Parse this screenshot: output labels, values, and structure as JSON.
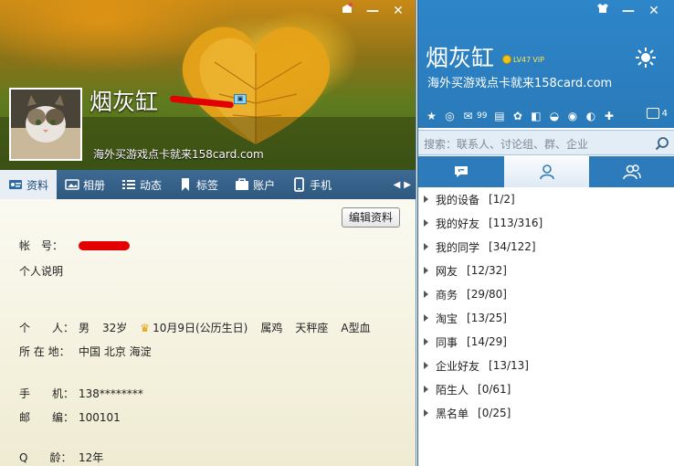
{
  "profile": {
    "nickname": "烟灰缸",
    "signature": "海外买游戏点卡就来158card.com",
    "edit_button": "编辑资料",
    "tabs": [
      {
        "label": "资料",
        "icon": "id-card-icon"
      },
      {
        "label": "相册",
        "icon": "photo-icon"
      },
      {
        "label": "动态",
        "icon": "feed-icon"
      },
      {
        "label": "标签",
        "icon": "bookmark-icon"
      },
      {
        "label": "账户",
        "icon": "wallet-icon"
      },
      {
        "label": "手机",
        "icon": "phone-icon"
      }
    ],
    "fields": {
      "account_label": "帐　号：",
      "bio_label": "个人说明",
      "personal_label": "个　　人：",
      "gender": "男",
      "age": "32岁",
      "birthday": "10月9日(公历生日)",
      "zodiac": "属鸡",
      "constellation": "天秤座",
      "blood": "A型血",
      "location_label": "所 在 地：",
      "location": "中国 北京 海淀",
      "mobile_label": "手　　机：",
      "mobile": "138********",
      "postcode_label": "邮　　编：",
      "postcode": "100101",
      "qage_label": "Q　　龄：",
      "qage": "12年"
    }
  },
  "qq": {
    "nickname": "烟灰缸",
    "level_text": "LV47",
    "vip_text": "VIP",
    "signature": "海外买游戏点卡就来158card.com",
    "mail_count": "99",
    "msgbox_count": "4",
    "search_placeholder": "搜索：联系人、讨论组、群、企业",
    "groups": [
      {
        "name": "我的设备",
        "count": "[1/2]"
      },
      {
        "name": "我的好友",
        "count": "[113/316]"
      },
      {
        "name": "我的同学",
        "count": "[34/122]"
      },
      {
        "name": "网友",
        "count": "[12/32]"
      },
      {
        "name": "商务",
        "count": "[29/80]"
      },
      {
        "name": "淘宝",
        "count": "[13/25]"
      },
      {
        "name": "同事",
        "count": "[14/29]"
      },
      {
        "name": "企业好友",
        "count": "[13/13]"
      },
      {
        "name": "陌生人",
        "count": "[0/61]"
      },
      {
        "name": "黑名单",
        "count": "[0/25]"
      }
    ]
  }
}
